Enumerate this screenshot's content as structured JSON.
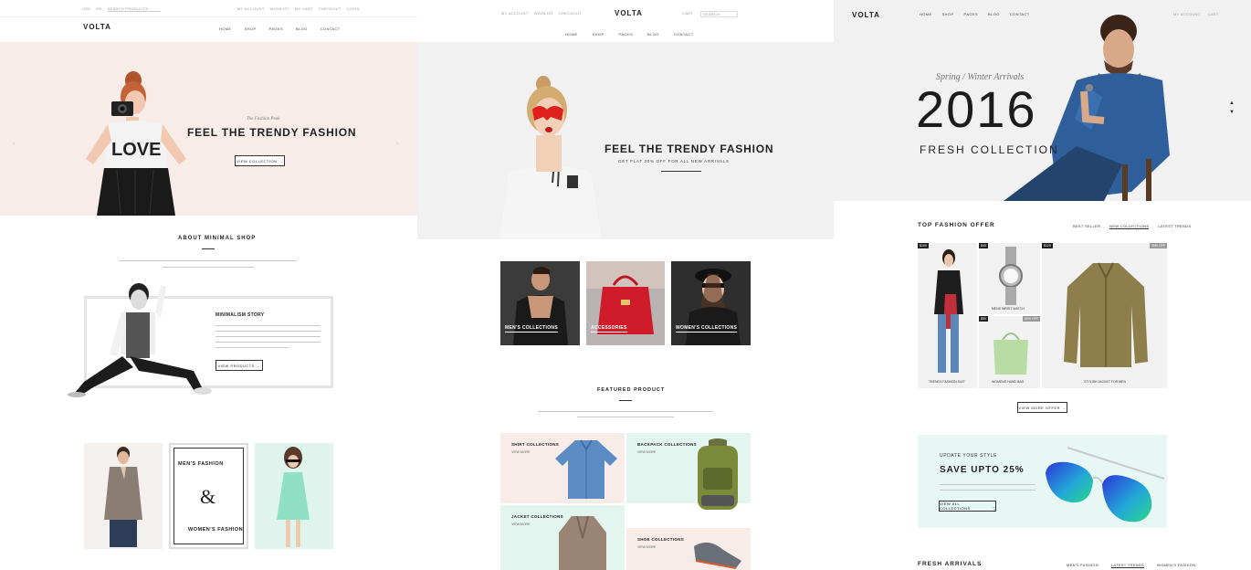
{
  "panel1": {
    "topbar": {
      "left_links": [
        "USD",
        "EN",
        "SEARCH PRODUCTS..."
      ],
      "right_links": [
        "MY ACCOUNT",
        "WISHLIST",
        "MY CART",
        "CHECKOUT",
        "LOGIN"
      ]
    },
    "logo": "VOLTA",
    "nav": [
      "HOME",
      "SHOP",
      "PAGES",
      "BLOG",
      "CONTACT"
    ],
    "hero": {
      "subtitle": "The Fashion Peak",
      "title": "FEEL THE TRENDY FASHION",
      "button": "VIEW COLLECTION",
      "shirt_text": "LOVE"
    },
    "about": {
      "title": "ABOUT MINIMAL SHOP"
    },
    "story": {
      "title": "MINIMALISM STORY",
      "button": "VIEW PRODUCTS"
    },
    "split": {
      "mens": "MEN'S FASHION",
      "amp": "&",
      "womens": "WOMEN'S FASHION"
    }
  },
  "panel2": {
    "topbar_left": [
      "MY ACCOUNT",
      "WISHLIST",
      "CHECKOUT"
    ],
    "logo": "VOLTA",
    "topbar_right": [
      "CART",
      "SEARCH"
    ],
    "nav": [
      "HOME",
      "SHOP",
      "PAGES",
      "BLOG",
      "CONTACT"
    ],
    "hero": {
      "title": "FEEL THE TRENDY FASHION",
      "subtitle": "GET FLAT 30% OFF FOR ALL NEW ARRIVALS"
    },
    "collections": [
      "MEN'S COLLECTIONS",
      "ACCESSORIES",
      "WOMEN'S COLLECTIONS"
    ],
    "featured": {
      "title": "FEATURED PRODUCT"
    },
    "tiles": [
      {
        "title": "SHIRT COLLECTIONS",
        "more": "VIEW MORE"
      },
      {
        "title": "BACKPACK COLLECTIONS",
        "more": "VIEW MORE"
      },
      {
        "title": "JACKET COLLECTIONS",
        "more": "VIEW MORE"
      },
      {
        "title": "SHOE COLLECTIONS",
        "more": "VIEW MORE"
      }
    ]
  },
  "panel3": {
    "logo": "VOLTA",
    "nav": [
      "HOME",
      "SHOP",
      "PAGES",
      "BLOG",
      "CONTACT"
    ],
    "topbar_right": [
      "MY ACCOUNT",
      "CART"
    ],
    "hero": {
      "eyebrow": "Spring / Winter Arrivals",
      "year": "2016",
      "title": "FRESH COLLECTION"
    },
    "offer": {
      "title": "TOP FASHION OFFER",
      "tabs": [
        "BEST SELLER",
        "NEW COLLECTIONS",
        "LATEST TRENDS"
      ],
      "products": [
        {
          "name": "TRENDY FASHION SUIT",
          "price": "$100"
        },
        {
          "name": "MENS WRIST WATCH",
          "price": "$45"
        },
        {
          "name": "WOMENS HAND BAG",
          "price": "$50",
          "badge": "50% OFF"
        },
        {
          "name": "STYLISH JACKET FOR MEN",
          "price": "$120",
          "badge": "25% OFF"
        }
      ],
      "button": "VIEW MORE OFFER"
    },
    "promo": {
      "eyebrow": "UPDATE YOUR STYLE",
      "title": "SAVE UPTO 25%",
      "button": "VIEW ALL COLLECTIONS"
    },
    "arrivals": {
      "title": "FRESH ARRIVALS",
      "tabs": [
        "MEN'S FASHION",
        "LATEST TRENDS",
        "WOMEN'S FASHION"
      ]
    }
  }
}
